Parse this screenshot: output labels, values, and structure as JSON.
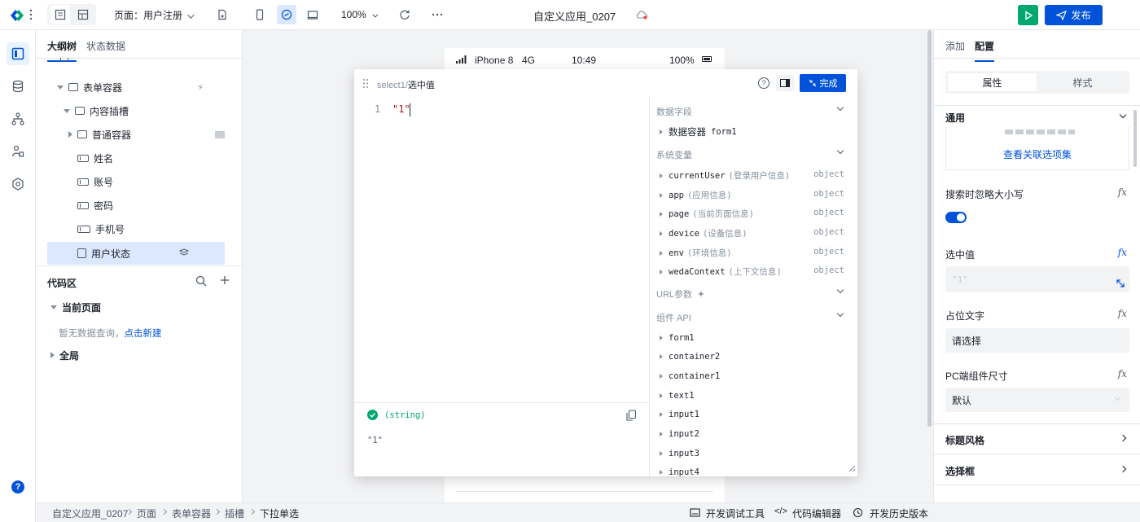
{
  "topbar": {
    "page_label": "页面：用户注册",
    "zoom": "100%",
    "app_title": "自定义应用_0207",
    "publish_label": "发布"
  },
  "left_panel": {
    "tabs": [
      "大纲树",
      "状态数据"
    ],
    "tree": [
      {
        "label": "表单容器"
      },
      {
        "label": "内容插槽"
      },
      {
        "label": "普通容器"
      },
      {
        "label": "姓名"
      },
      {
        "label": "账号"
      },
      {
        "label": "密码"
      },
      {
        "label": "手机号"
      },
      {
        "label": "用户状态"
      }
    ],
    "code_section": {
      "title": "代码区",
      "current_page": "当前页面",
      "empty_text": "暂无数据查询，",
      "create_link": "点击新建",
      "global": "全局"
    }
  },
  "phone": {
    "device": "iPhone 8",
    "network": "4G",
    "time": "10:49",
    "battery": "100%"
  },
  "editor": {
    "crumb_prefix": "select1/",
    "crumb_current": "选中值",
    "done_label": "完成",
    "line_number": "1",
    "code": "\"1\"",
    "result_type": "(string)",
    "result_value": "\"1\"",
    "side": {
      "data_fields_title": "数据字段",
      "data_fields": [
        {
          "label": "数据容器",
          "id": "form1"
        }
      ],
      "system_vars_title": "系统变量",
      "system_vars": [
        {
          "name": "currentUser",
          "desc": "(登录用户信息)",
          "type": "object"
        },
        {
          "name": "app",
          "desc": "(应用信息)",
          "type": "object"
        },
        {
          "name": "page",
          "desc": "(当前页面信息)",
          "type": "object"
        },
        {
          "name": "device",
          "desc": "(设备信息)",
          "type": "object"
        },
        {
          "name": "env",
          "desc": "(环境信息)",
          "type": "object"
        },
        {
          "name": "wedaContext",
          "desc": "(上下文信息)",
          "type": "object"
        }
      ],
      "url_params_title": "URL参数",
      "component_api_title": "组件 API",
      "components": [
        "form1",
        "container2",
        "container1",
        "text1",
        "input1",
        "input2",
        "input3",
        "input4"
      ]
    }
  },
  "right_panel": {
    "tabs": [
      "添加",
      "配置"
    ],
    "segments": [
      "属性",
      "样式"
    ],
    "general_title": "通用",
    "view_options_link": "查看关联选项集",
    "ignore_case_label": "搜索时忽略大小写",
    "selected_value_label": "选中值",
    "selected_value": "\"1\"",
    "placeholder_label": "占位文字",
    "placeholder_value": "请选择",
    "pc_size_label": "PC端组件尺寸",
    "pc_size_value": "默认",
    "title_style": "标题风格",
    "select_box": "选择框"
  },
  "statusbar": {
    "breadcrumbs": [
      "自定义应用_0207",
      "页面",
      "表单容器",
      "插槽",
      "下拉单选"
    ],
    "tools": [
      "开发调试工具",
      "代码编辑器",
      "开发历史版本"
    ]
  },
  "colors": {
    "brand": "#0052d9",
    "run": "#00a870",
    "selected_row": "#dbe8ff"
  }
}
